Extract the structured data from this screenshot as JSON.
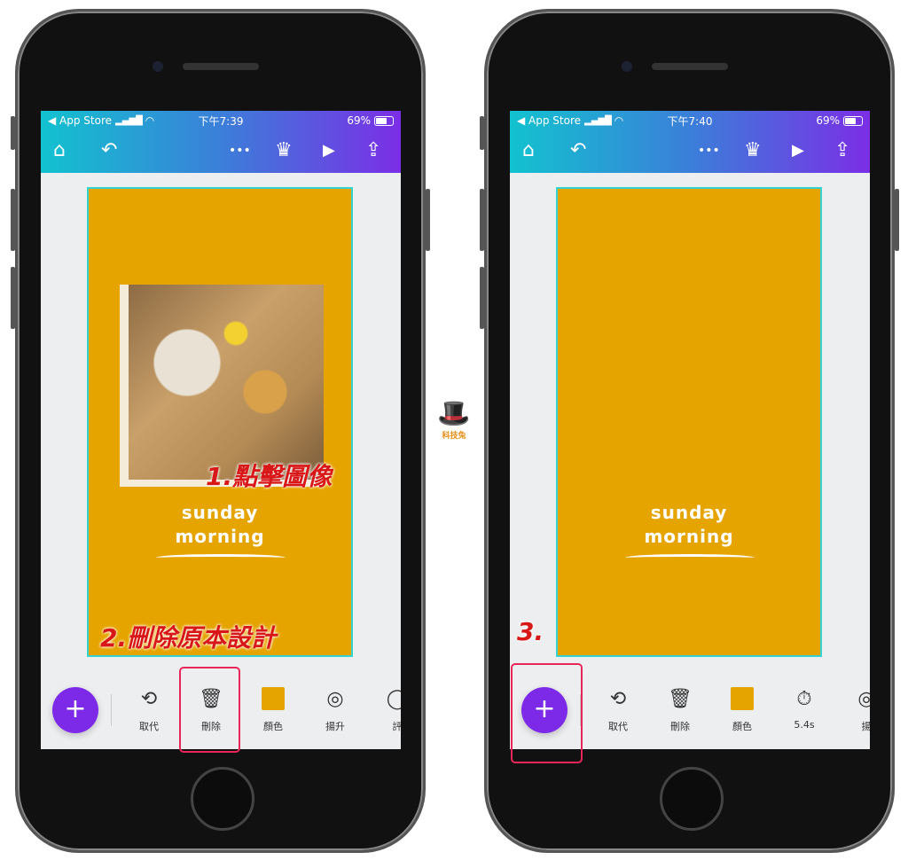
{
  "phones": [
    {
      "status": {
        "carrier": "◀ App Store",
        "time": "下午7:39",
        "battery": "69%"
      },
      "nav": {
        "home": "⌂",
        "undo": "↶",
        "more": "•••",
        "crown": "♛",
        "play": "▶",
        "share": "⇪"
      },
      "design": {
        "title_line1": "sunday",
        "title_line2": "morning",
        "has_photo": true
      },
      "toolbar": [
        {
          "icon": "replace-icon",
          "glyph": "⟲",
          "label": "取代"
        },
        {
          "icon": "trash-icon",
          "glyph": "🗑",
          "label": "刪除"
        },
        {
          "icon": "color-swatch",
          "glyph": "",
          "label": "顏色"
        },
        {
          "icon": "layers-icon",
          "glyph": "◎",
          "label": "揚升"
        },
        {
          "icon": "partial-icon",
          "glyph": "◯",
          "label": "評"
        }
      ],
      "annotations": {
        "step1": "1.點擊圖像",
        "step2": "2.刪除原本設計"
      }
    },
    {
      "status": {
        "carrier": "◀ App Store",
        "time": "下午7:40",
        "battery": "69%"
      },
      "nav": {
        "home": "⌂",
        "undo": "↶",
        "more": "•••",
        "crown": "♛",
        "play": "▶",
        "share": "⇪"
      },
      "design": {
        "title_line1": "sunday",
        "title_line2": "morning",
        "has_photo": false
      },
      "toolbar": [
        {
          "icon": "replace-icon",
          "glyph": "⟲",
          "label": "取代"
        },
        {
          "icon": "trash-icon",
          "glyph": "🗑",
          "label": "刪除"
        },
        {
          "icon": "color-swatch",
          "glyph": "",
          "label": "顏色"
        },
        {
          "icon": "timer-icon",
          "glyph": "⏱",
          "label": "5.4s"
        },
        {
          "icon": "partial-icon",
          "glyph": "◎",
          "label": "揚"
        }
      ],
      "annotations": {
        "step3": "3."
      }
    }
  ],
  "logo": {
    "text": "科技兔"
  },
  "colors": {
    "accent": "#7d2ae8",
    "canvas": "#e6a400",
    "highlight": "#e8265a",
    "annotation": "#d81818"
  }
}
